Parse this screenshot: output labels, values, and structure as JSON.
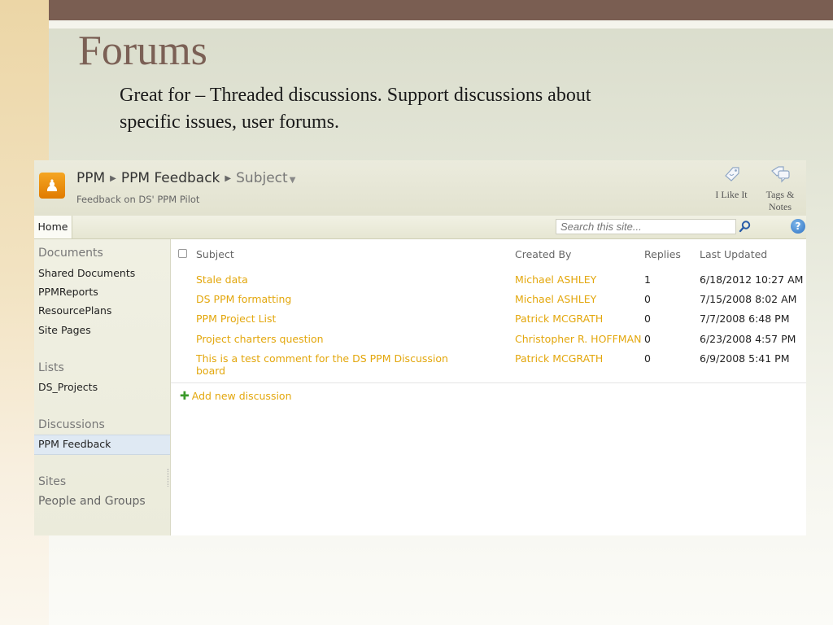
{
  "slide": {
    "title": "Forums",
    "body_line1": "Great for – Threaded discussions.  Support discussions about",
    "body_line2": "specific issues, user forums."
  },
  "sharepoint": {
    "breadcrumb": {
      "root": "PPM",
      "list": "PPM Feedback",
      "view": "Subject"
    },
    "site_description": "Feedback on DS' PPM Pilot",
    "actions": {
      "i_like_it": "I Like It",
      "tags_line1": "Tags &",
      "tags_line2": "Notes"
    },
    "nav": {
      "home": "Home",
      "search_placeholder": "Search this site...",
      "help": "?"
    },
    "quick_launch": {
      "documents_heading": "Documents",
      "documents": [
        "Shared Documents",
        "PPMReports",
        "ResourcePlans",
        "Site Pages"
      ],
      "lists_heading": "Lists",
      "lists": [
        "DS_Projects"
      ],
      "discussions_heading": "Discussions",
      "discussions": [
        "PPM Feedback"
      ],
      "sites_heading": "Sites",
      "people_and_groups": "People and Groups"
    },
    "table": {
      "headers": {
        "subject": "Subject",
        "created_by": "Created By",
        "replies": "Replies",
        "last_updated": "Last Updated"
      },
      "rows": [
        {
          "subject": "Stale data",
          "created_by": "Michael ASHLEY",
          "replies": "1",
          "last_updated": "6/18/2012 10:27 AM"
        },
        {
          "subject": "DS PPM formatting",
          "created_by": "Michael ASHLEY",
          "replies": "0",
          "last_updated": "7/15/2008 8:02 AM"
        },
        {
          "subject": "PPM Project List",
          "created_by": "Patrick MCGRATH",
          "replies": "0",
          "last_updated": "7/7/2008 6:48 PM"
        },
        {
          "subject": "Project charters question",
          "created_by": "Christopher R. HOFFMAN",
          "replies": "0",
          "last_updated": "6/23/2008 4:57 PM"
        },
        {
          "subject_line1": "This is a test comment for the DS PPM Discussion",
          "subject_line2": "board",
          "created_by": "Patrick MCGRATH",
          "replies": "0",
          "last_updated": "6/9/2008 5:41 PM"
        }
      ],
      "add_new": "Add new discussion"
    },
    "colors": {
      "link": "#e3a70d",
      "header_bg": "#e2e2cf",
      "selected": "#dfe9f3"
    }
  }
}
